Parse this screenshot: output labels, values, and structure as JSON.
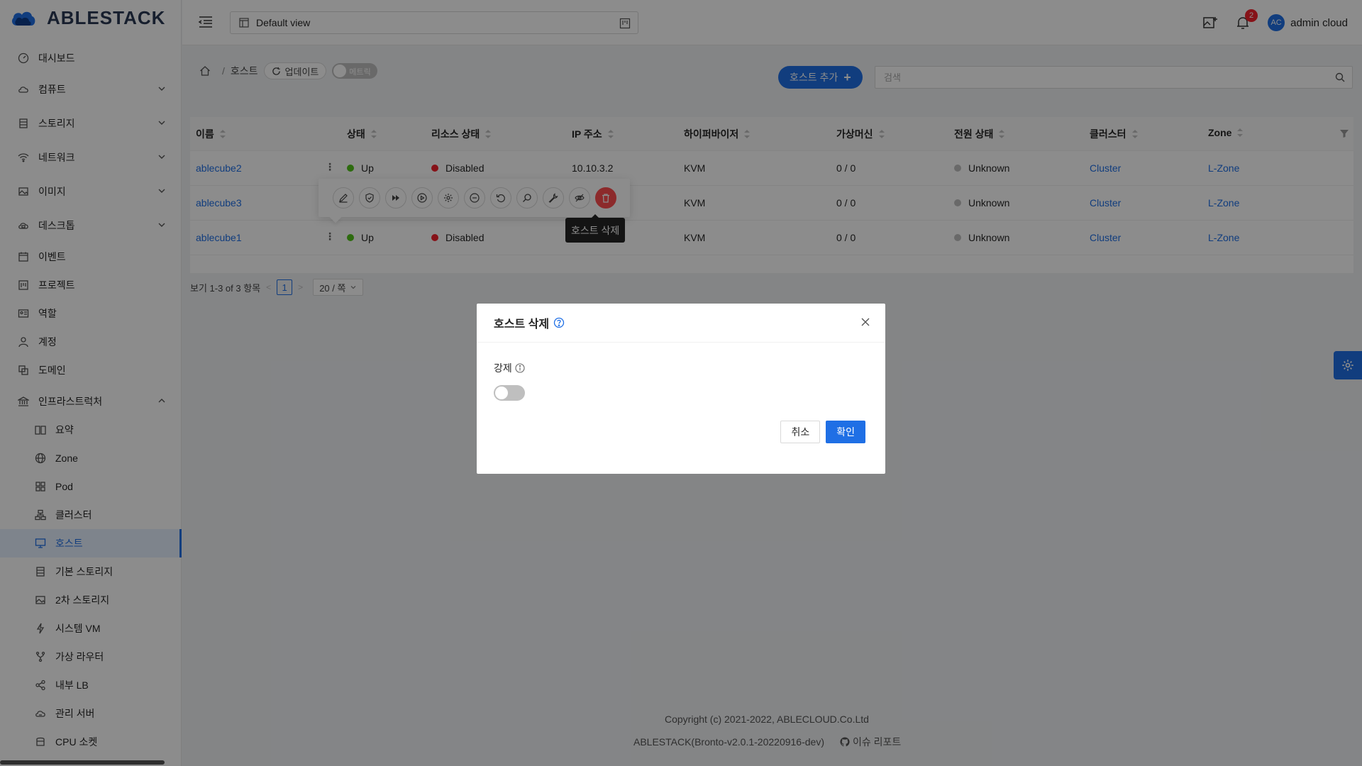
{
  "app": {
    "logo_text": "ABLESTACK"
  },
  "header": {
    "view_select": "Default view",
    "notifications_count": "2",
    "avatar_initials": "AC",
    "user_name": "admin cloud"
  },
  "sidebar": {
    "items": [
      {
        "label": "대시보드"
      },
      {
        "label": "컴퓨트"
      },
      {
        "label": "스토리지"
      },
      {
        "label": "네트워크"
      },
      {
        "label": "이미지"
      },
      {
        "label": "데스크톱"
      },
      {
        "label": "이벤트"
      },
      {
        "label": "프로젝트"
      },
      {
        "label": "역할"
      },
      {
        "label": "계정"
      },
      {
        "label": "도메인"
      },
      {
        "label": "인프라스트럭처"
      }
    ],
    "sub_items": [
      {
        "label": "요약"
      },
      {
        "label": "Zone"
      },
      {
        "label": "Pod"
      },
      {
        "label": "클러스터"
      },
      {
        "label": "호스트"
      },
      {
        "label": "기본 스토리지"
      },
      {
        "label": "2차 스토리지"
      },
      {
        "label": "시스템 VM"
      },
      {
        "label": "가상 라우터"
      },
      {
        "label": "내부 LB"
      },
      {
        "label": "관리 서버"
      },
      {
        "label": "CPU 소켓"
      }
    ]
  },
  "breadcrumb": {
    "current": "호스트",
    "update_label": "업데이트",
    "metrics_label": "메트릭"
  },
  "toolbar": {
    "add_host_label": "호스트 추가",
    "search_placeholder": "검색"
  },
  "table": {
    "columns": [
      "이름",
      "상태",
      "리소스 상태",
      "IP 주소",
      "하이퍼바이저",
      "가상머신",
      "전원 상태",
      "클러스터",
      "Zone"
    ],
    "rows": [
      {
        "name": "ablecube2",
        "state": "Up",
        "resource_state": "Disabled",
        "ip": "10.10.3.2",
        "hypervisor": "KVM",
        "vms": "0 / 0",
        "power": "Unknown",
        "cluster": "Cluster",
        "zone": "L-Zone"
      },
      {
        "name": "ablecube3",
        "state": "",
        "resource_state": "",
        "ip": "",
        "hypervisor": "KVM",
        "vms": "0 / 0",
        "power": "Unknown",
        "cluster": "Cluster",
        "zone": "L-Zone"
      },
      {
        "name": "ablecube1",
        "state": "Up",
        "resource_state": "Disabled",
        "ip": "",
        "hypervisor": "KVM",
        "vms": "0 / 0",
        "power": "Unknown",
        "cluster": "Cluster",
        "zone": "L-Zone"
      }
    ]
  },
  "pagination": {
    "summary": "보기 1-3 of 3 항목",
    "current_page": "1",
    "page_size": "20 / 쪽"
  },
  "popover": {
    "actions": [
      "edit-icon",
      "shield-check-icon",
      "fast-forward-icon",
      "play-circle-icon",
      "gear-icon",
      "minus-circle-icon",
      "undo-icon",
      "search-icon",
      "wrench-icon",
      "eye-off-icon",
      "trash-icon"
    ],
    "tooltip": "호스트 삭제"
  },
  "modal": {
    "title": "호스트 삭제",
    "force_label": "강제",
    "cancel_label": "취소",
    "ok_label": "확인"
  },
  "footer": {
    "copyright": "Copyright (c) 2021-2022, ABLECLOUD.Co.Ltd",
    "version": "ABLESTACK(Bronto-v2.0.1-20220916-dev)",
    "issue_label": "이슈 리포트"
  },
  "colors": {
    "primary": "#1f6fe5",
    "danger": "#ff4d4f",
    "up": "#52c41a",
    "disabled": "#f5222d",
    "unknown": "#bfbfbf"
  }
}
